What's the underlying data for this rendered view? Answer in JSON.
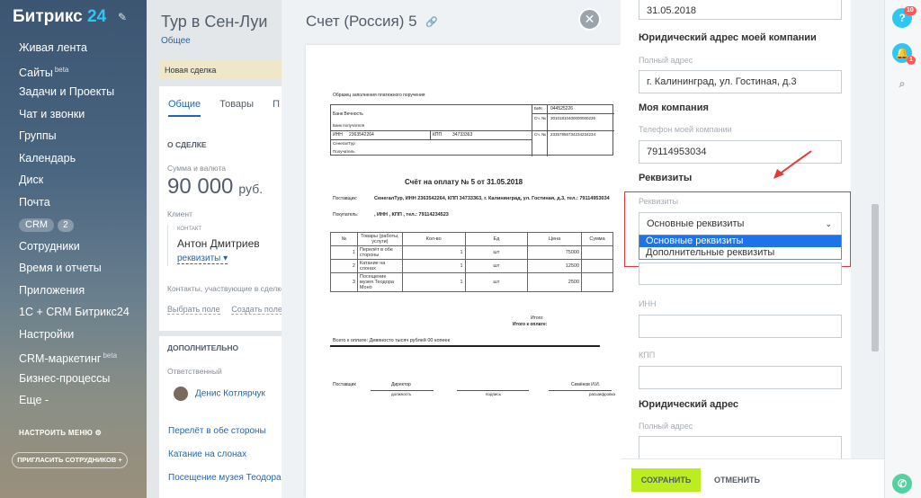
{
  "sidebar": {
    "logo_text": "Битрикс",
    "logo_num": "24",
    "items": [
      {
        "label": "Живая лента"
      },
      {
        "label": "Сайты",
        "sup": "beta"
      },
      {
        "label": "Задачи и Проекты"
      },
      {
        "label": "Чат и звонки"
      },
      {
        "label": "Группы"
      },
      {
        "label": "Календарь"
      },
      {
        "label": "Диск"
      },
      {
        "label": "Почта"
      },
      {
        "label": "CRM",
        "count": "2"
      },
      {
        "label": "Сотрудники"
      },
      {
        "label": "Время и отчеты"
      },
      {
        "label": "Приложения"
      },
      {
        "label": "1С + CRM Битрикс24"
      },
      {
        "label": "Настройки"
      },
      {
        "label": "CRM-маркетинг",
        "sup": "beta"
      },
      {
        "label": "Бизнес-процессы"
      },
      {
        "label": "Еще -"
      }
    ],
    "config_menu": "НАСТРОИТЬ МЕНЮ",
    "invite": "ПРИГЛАСИТЬ СОТРУДНИКОВ"
  },
  "deal": {
    "title": "Тур в Сен-Луи",
    "subtitle": "Общее",
    "stage": "Новая сделка",
    "tabs": [
      "Общие",
      "Товары",
      "П"
    ],
    "about_head": "О СДЕЛКЕ",
    "amount_label": "Сумма и валюта",
    "amount": "90 000",
    "currency": "руб.",
    "client_label": "Клиент",
    "contact_label": "КОНТАКТ",
    "client_name": "Антон Дмитриев",
    "client_req": "реквизиты",
    "participants": "Контакты, участвующие в сделке",
    "select_field": "Выбрать поле",
    "create_field": "Создать поле",
    "extra_head": "ДОПОЛНИТЕЛЬНО",
    "responsible_label": "Ответственный",
    "responsible": "Денис Котлярчук",
    "products": [
      "Перелёт в обе стороны",
      "Катание на слонах",
      "Посещение музея Теодора М"
    ]
  },
  "invoice": {
    "title": "Счет (Россия) 5",
    "doc": {
      "sample": "Образец заполнения платежного поручения",
      "bank": "Банк Вечность",
      "bank_recipient": "Банк получателя",
      "bik_label": "БИК",
      "bik": "044525226",
      "sch_label": "Сч. №",
      "acc1": "30101810400000000226",
      "inn_label": "ИНН",
      "inn": "2363542264",
      "kpp_label": "КПП",
      "kpp": "34733363",
      "acc2": "23357856734234234234",
      "company": "СенегалТур",
      "recipient": "Получатель",
      "heading": "Счёт на оплату № 5 от 31.05.2018",
      "supplier_label": "Поставщик:",
      "supplier": "СенегалТур, ИНН 2363542264, КПП 34733363, г. Калининград, ул. Гостиная, д.3, тел.: 79114953034",
      "buyer_label": "Покупатель:",
      "buyer": ", ИНН , КПП , тел.: 79114234523",
      "cols": [
        "№",
        "Товары (работы, услуги)",
        "Кол-во",
        "Ед",
        "Цена",
        "Сумма"
      ],
      "rows": [
        {
          "n": "1",
          "name": "Перелёт в обе стороны",
          "qty": "1",
          "unit": "шт",
          "price": "75000"
        },
        {
          "n": "2",
          "name": "Катание на слонах",
          "qty": "1",
          "unit": "шт",
          "price": "12500"
        },
        {
          "n": "3",
          "name": "Посещение музея Теодора Моно",
          "qty": "1",
          "unit": "шт",
          "price": "2500"
        }
      ],
      "total_label": "Итого:",
      "total_vat": "Итого к оплате:",
      "total_words": "Всего к оплате: Девяносто тысяч рублей 00 копеек",
      "supplier_sign": "Поставщик",
      "director": "Директор",
      "position": "должность",
      "signature": "подпись",
      "name": "Семёнов И.И.",
      "decoding": "расшифровка"
    }
  },
  "form": {
    "date_value": "31.05.2018",
    "company_address_head": "Юридический адрес моей компании",
    "full_address_label": "Полный адрес",
    "full_address_value": "г. Калининград, ул. Гостиная, д.3",
    "my_company_head": "Моя компания",
    "phone_label": "Телефон моей компании",
    "phone_value": "79114953034",
    "requisites_head": "Реквизиты",
    "requisites_label": "Реквизиты",
    "select_value": "Основные реквизиты",
    "options": [
      "Основные реквизиты",
      "Дополнительные реквизиты"
    ],
    "inn_label": "ИНН",
    "kpp_label": "КПП",
    "legal_address_head": "Юридический адрес",
    "legal_full_address_label": "Полный адрес",
    "save": "СОХРАНИТЬ",
    "cancel": "ОТМЕНИТЬ"
  },
  "right_panel": {
    "help_badge": "10",
    "bell_badge": "1"
  },
  "colors": {
    "accent": "#2067b0",
    "save_button": "#bbed21",
    "highlight": "#e53935",
    "selected_option": "#1e73e8"
  }
}
